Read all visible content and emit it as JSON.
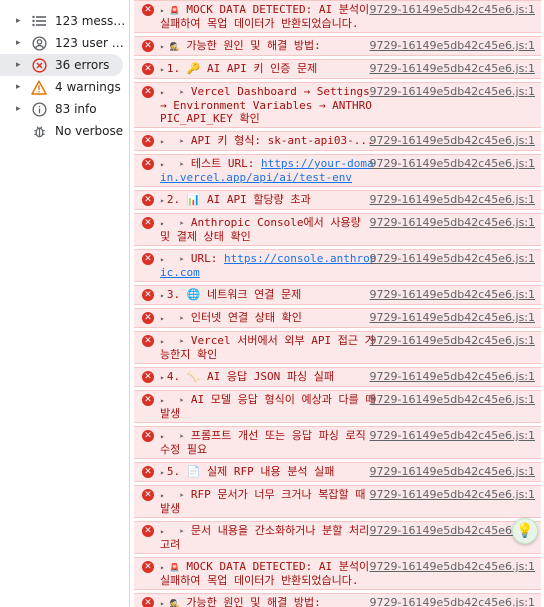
{
  "sidebar": {
    "items": [
      {
        "label": "123 mess…",
        "icon": "list-icon",
        "selected": false
      },
      {
        "label": "123 user …",
        "icon": "user-circle-icon",
        "selected": false
      },
      {
        "label": "36 errors",
        "icon": "error-circle-icon",
        "selected": true
      },
      {
        "label": "4 warnings",
        "icon": "warning-triangle-icon",
        "selected": false
      },
      {
        "label": "83 info",
        "icon": "info-icon",
        "selected": false
      },
      {
        "label": "No verbose",
        "icon": "bug-icon",
        "selected": false
      }
    ]
  },
  "log": {
    "source": "9729-16149e5db42c45e6.js:1",
    "rows": [
      {
        "prefix": "▸ 🚨 ",
        "text": "MOCK DATA DETECTED: AI 분석이 실패하여 목업 데이터가 반환되었습니다."
      },
      {
        "prefix": "▸ 🕵️ ",
        "text": "가능한 원인 및 해결 방법:"
      },
      {
        "prefix": "▸",
        "text": "1. 🔑 AI API 키 인증 문제"
      },
      {
        "prefix": "▸   ➤ ",
        "text": "Vercel Dashboard → Settings → Environment Variables → ANTHROPIC_API_KEY 확인"
      },
      {
        "prefix": "▸   ➤ ",
        "text": "API 키 형식: sk-ant-api03-..."
      },
      {
        "prefix": "▸   ➤ ",
        "text": "테스트 URL: ",
        "link": "https://your-domain.vercel.app/api/ai/test-env"
      },
      {
        "prefix": "▸",
        "text": "2. 📊 AI API 할당량 초과"
      },
      {
        "prefix": "▸   ➤ ",
        "text": "Anthropic Console에서 사용량 및 결제 상태 확인"
      },
      {
        "prefix": "▸   ➤ ",
        "text": "URL: ",
        "link": "https://console.anthropic.com"
      },
      {
        "prefix": "▸",
        "text": "3. 🌐 네트워크 연결 문제"
      },
      {
        "prefix": "▸   ➤ ",
        "text": "인터넷 연결 상태 확인"
      },
      {
        "prefix": "▸   ➤ ",
        "text": "Vercel 서버에서 외부 API 접근 가능한지 확인"
      },
      {
        "prefix": "▸",
        "text": "4. 🦴 AI 응답 JSON 파싱 실패"
      },
      {
        "prefix": "▸   ➤ ",
        "text": "AI 모델 응답 형식이 예상과 다를 때 발생"
      },
      {
        "prefix": "▸   ➤ ",
        "text": "프롬프트 개선 또는 응답 파싱 로직 수정 필요"
      },
      {
        "prefix": "▸",
        "text": "5. 📄 실제 RFP 내용 분석 실패"
      },
      {
        "prefix": "▸   ➤ ",
        "text": "RFP 문서가 너무 크거나 복잡할 때 발생"
      },
      {
        "prefix": "▸   ➤ ",
        "text": "문서 내용을 간소화하거나 분할 처리 고려"
      },
      {
        "prefix": "▸ 🚨 ",
        "text": "MOCK DATA DETECTED: AI 분석이 실패하여 목업 데이터가 반환되었습니다."
      },
      {
        "prefix": "▸ 🕵️ ",
        "text": "가능한 원인 및 해결 방법:"
      }
    ]
  },
  "fab": {
    "icon": "lightbulb-icon",
    "glyph": "💡"
  },
  "colors": {
    "error_bg": "#fce8e8",
    "error_text": "#a50e0e",
    "error_icon": "#d93025",
    "link": "#1a73e8"
  }
}
